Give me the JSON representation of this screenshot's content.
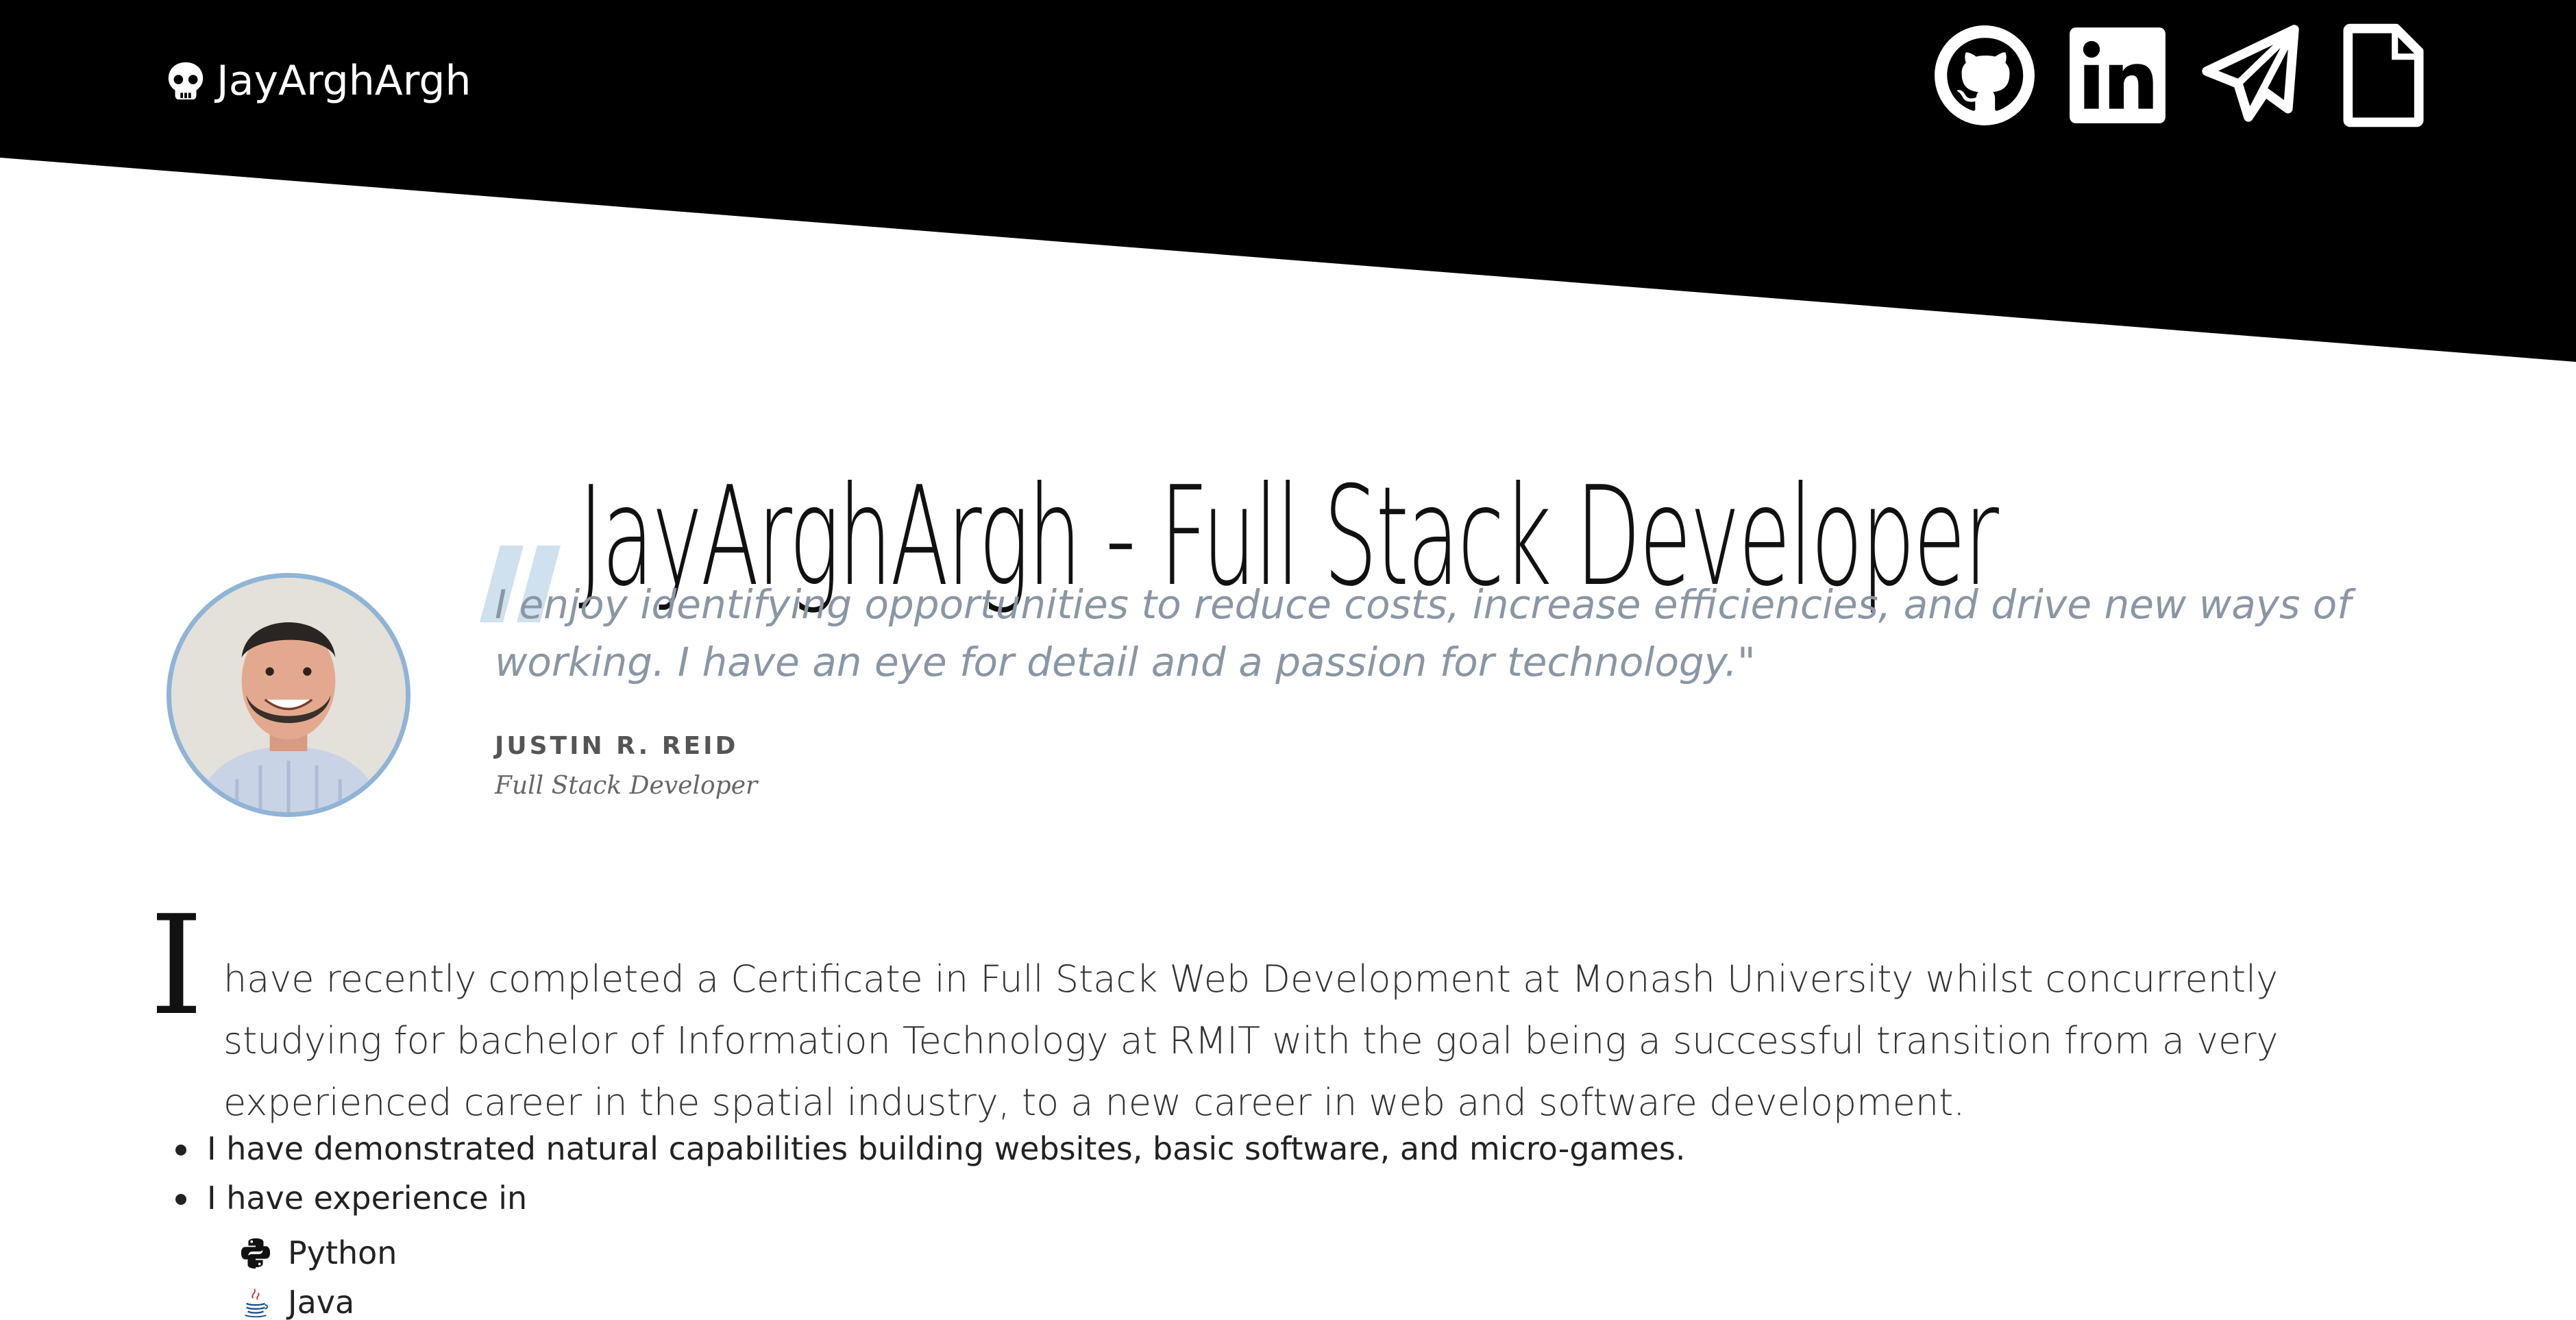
{
  "header": {
    "brand_icon": "skull-icon",
    "brand_name": "JayArghArgh",
    "social_links": [
      {
        "name": "github",
        "icon": "github-icon"
      },
      {
        "name": "linkedin",
        "icon": "linkedin-icon"
      },
      {
        "name": "telegram",
        "icon": "paper-plane-icon"
      },
      {
        "name": "resume",
        "icon": "document-icon"
      }
    ]
  },
  "hero": {
    "title": "JayArghArgh - Full Stack Developer"
  },
  "testimonial": {
    "quote": "I enjoy identifying opportunities to reduce costs, increase efficiencies, and drive new ways of working. I have an eye for detail and a passion for technology.\"",
    "author": "JUSTIN R. REID",
    "role": "Full Stack Developer"
  },
  "intro": {
    "drop_cap": "I",
    "text": "have recently completed a Certificate in Full Stack Web Development at Monash University whilst concurrently studying for bachelor of Information Technology at RMIT with the goal being a successful transition from a very experienced career in the spatial industry, to a new career in web and software development."
  },
  "highlights": [
    "I have demonstrated natural capabilities building websites, basic software, and micro-games.",
    "I have experience in"
  ],
  "skills": [
    {
      "label": "Python",
      "icon": "python-icon"
    },
    {
      "label": "Java",
      "icon": "java-icon"
    }
  ],
  "colors": {
    "header_bg": "#000000",
    "accent_border": "#8fb4d6",
    "quote_text": "#8a96a4",
    "quote_mark": "#cfe0ee"
  }
}
